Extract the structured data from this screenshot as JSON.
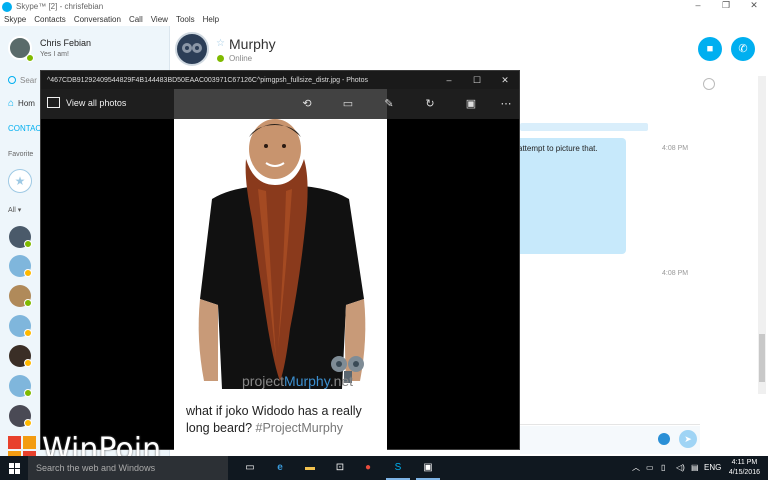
{
  "skype": {
    "window_title": "Skype™ [2] - chrisfebian",
    "window_controls": [
      "–",
      "❐",
      "✕"
    ],
    "menu": [
      "Skype",
      "Contacts",
      "Conversation",
      "Call",
      "View",
      "Tools",
      "Help"
    ],
    "profile": {
      "name": "Chris Febian",
      "mood": "Yes I am!"
    },
    "search_placeholder": "Sear",
    "home_label": "Hom",
    "contacts_tab": "CONTAC",
    "favorites_label": "Favorite",
    "all_label": "All",
    "contacts": [
      {
        "color": "#4a5a6a",
        "status": "#7fba00"
      },
      {
        "color": "#7fb6dc",
        "status": "#ffb900"
      },
      {
        "color": "#b08a5a",
        "status": "#7fba00"
      },
      {
        "color": "#7fb6dc",
        "status": "#ffb900"
      },
      {
        "color": "#3a2e26",
        "status": "#ffb900"
      },
      {
        "color": "#7fb6dc",
        "status": "#7fba00"
      },
      {
        "color": "#4a4a55",
        "status": "#ffb900"
      }
    ],
    "conversation": {
      "name": "Murphy",
      "status": "Online",
      "video_icon": "video-camera-icon",
      "call_icon": "phone-icon"
    },
    "messages": [
      {
        "text": "attempt to picture that.",
        "time": "4:08 PM"
      },
      {
        "text": "",
        "time": "4:08 PM"
      }
    ]
  },
  "photos": {
    "title": "^467CDB91292409544829F4B144483BD50EAAC003971C67126C^pimgpsh_fullsize_distr.jpg - Photos",
    "window_controls": [
      "–",
      "☐",
      "✕"
    ],
    "view_all_label": "View all photos",
    "tools": [
      "share-icon",
      "slideshow-icon",
      "edit-icon",
      "rotate-icon",
      "save-icon",
      "more-icon"
    ],
    "watermark_prefix": "project",
    "watermark_brand": "Murphy",
    "watermark_suffix": ".net",
    "caption": "what if joko Widodo has a really long beard?",
    "hashtag": "#ProjectMurphy"
  },
  "watermark": {
    "text": "WinPoin"
  },
  "taskbar": {
    "search_placeholder": "Search the web and Windows",
    "apps": [
      "task-view-icon",
      "edge-icon",
      "file-explorer-icon",
      "store-icon",
      "chrome-icon",
      "skype-icon",
      "photos-icon"
    ],
    "language": "ENG",
    "time": "4:11 PM",
    "date": "4/15/2016"
  }
}
